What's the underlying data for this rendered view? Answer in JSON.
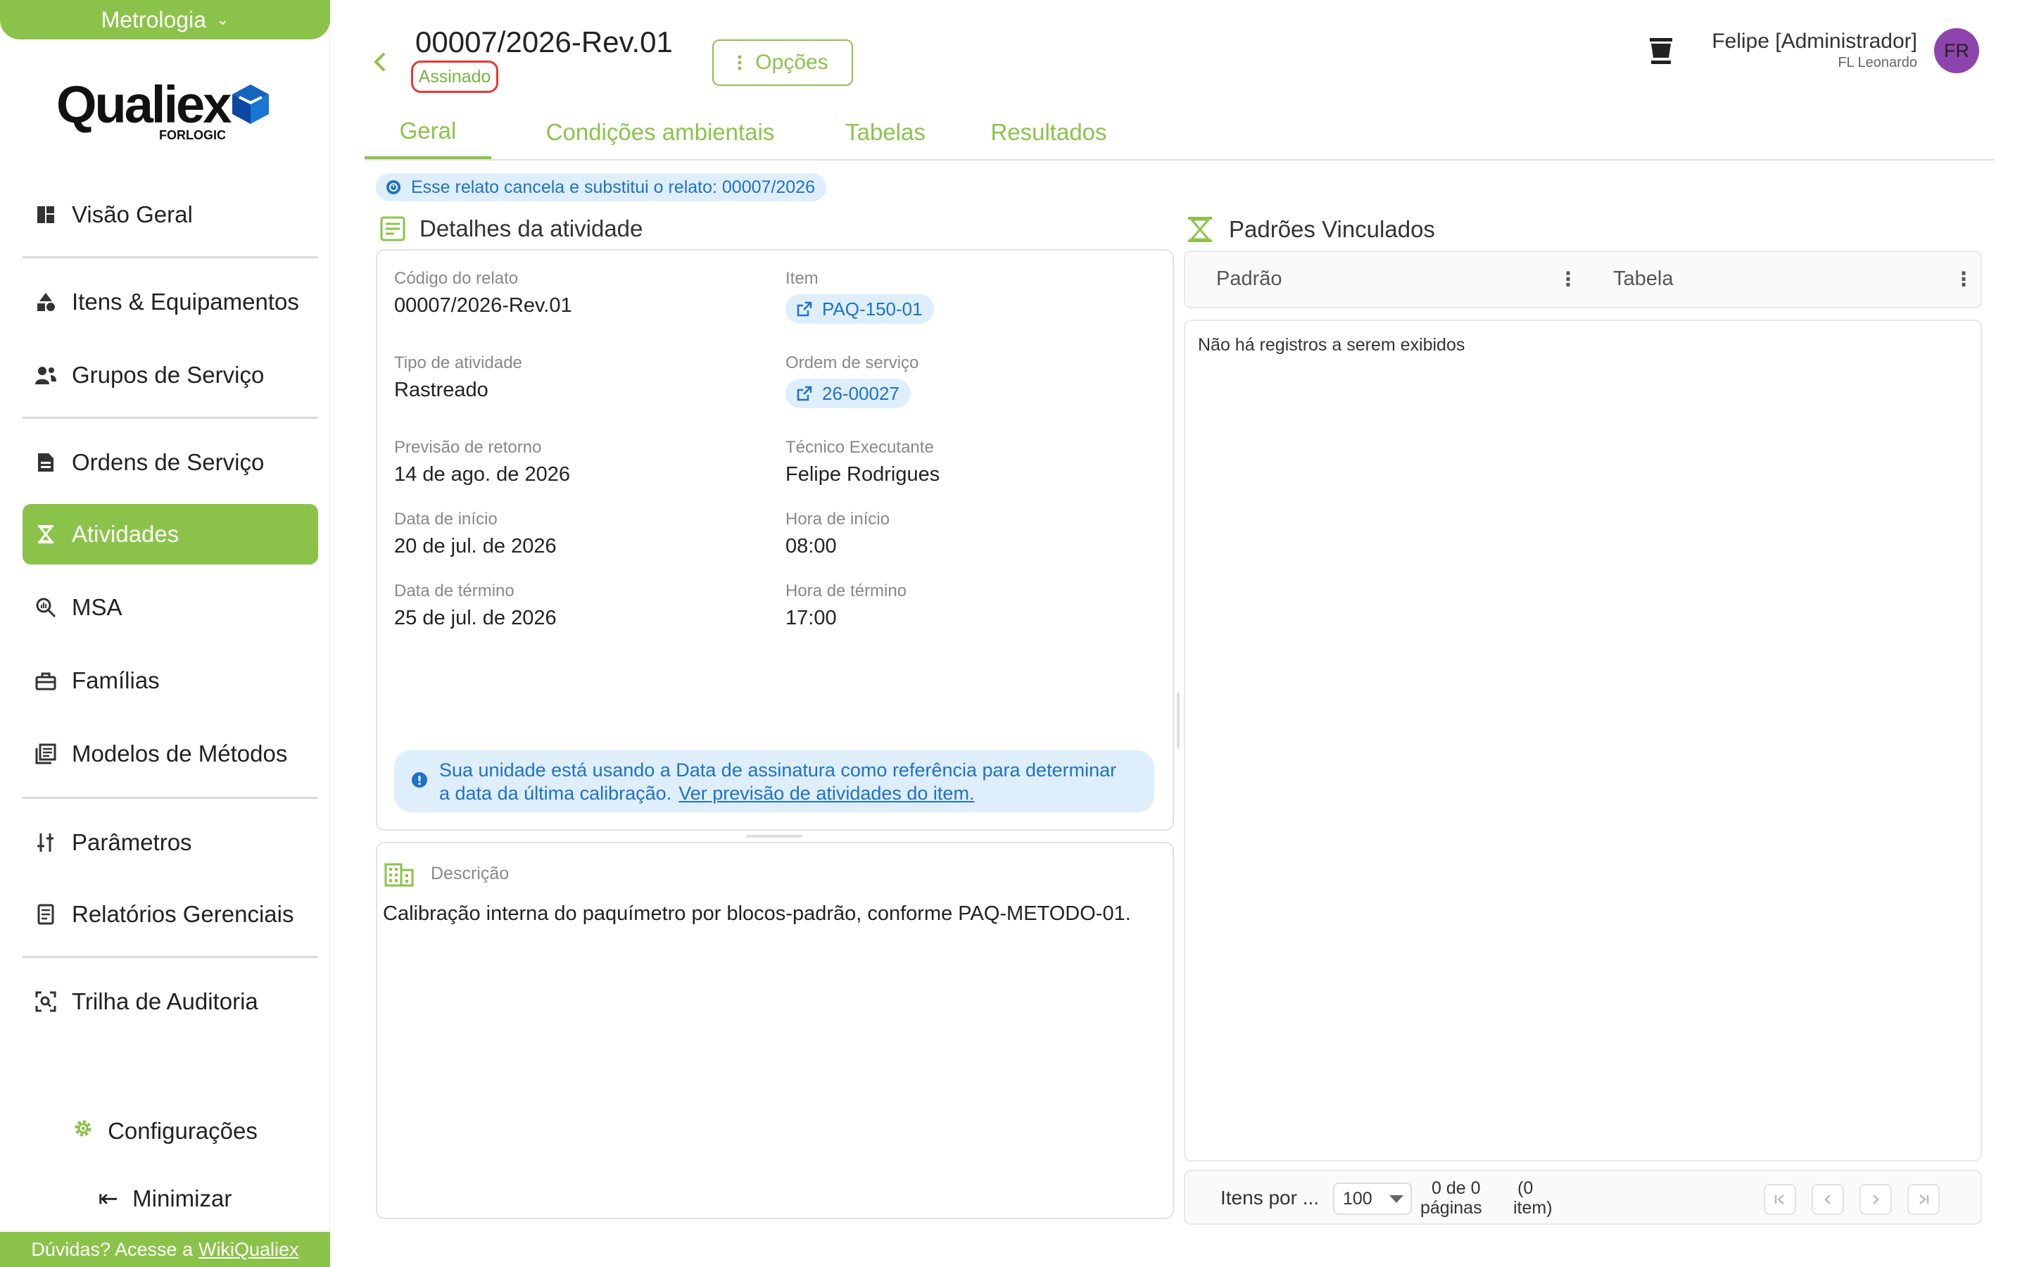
{
  "sidebar": {
    "module_label": "Metrologia",
    "logo_text": "Qualiex",
    "logo_sub": "FORLOGIC",
    "items": [
      {
        "label": "Visão Geral"
      },
      {
        "label": "Itens & Equipamentos"
      },
      {
        "label": "Grupos de Serviço"
      },
      {
        "label": "Ordens de Serviço"
      },
      {
        "label": "Atividades"
      },
      {
        "label": "MSA"
      },
      {
        "label": "Famílias"
      },
      {
        "label": "Modelos de Métodos"
      },
      {
        "label": "Parâmetros"
      },
      {
        "label": "Relatórios Gerenciais"
      },
      {
        "label": "Trilha de Auditoria"
      }
    ],
    "active_item": "Atividades",
    "settings_label": "Configurações",
    "minimize_label": "Minimizar",
    "help_text": "Dúvidas? Acesse a",
    "help_link": "WikiQualiex"
  },
  "header": {
    "title": "00007/2026-Rev.01",
    "status": "Assinado",
    "options_label": "Opções",
    "user_name": "Felipe [Administrador]",
    "user_sub": "FL Leonardo",
    "avatar_initials": "FR"
  },
  "tabs": [
    {
      "label": "Geral"
    },
    {
      "label": "Condições ambientais"
    },
    {
      "label": "Tabelas"
    },
    {
      "label": "Resultados"
    }
  ],
  "info_chip": "Esse relato cancela e substitui o relato: 00007/2026",
  "details": {
    "section_title": "Detalhes da atividade",
    "codigo_label": "Código do relato",
    "codigo_value": "00007/2026-Rev.01",
    "item_label": "Item",
    "item_value": "PAQ-150-01",
    "tipo_label": "Tipo de atividade",
    "tipo_value": "Rastreado",
    "ordem_label": "Ordem de serviço",
    "ordem_value": "26-00027",
    "previsao_label": "Previsão de retorno",
    "previsao_value": "14 de ago. de 2026",
    "tecnico_label": "Técnico Executante",
    "tecnico_value": "Felipe Rodrigues",
    "data_inicio_label": "Data de início",
    "data_inicio_value": "20 de jul. de 2026",
    "hora_inicio_label": "Hora de início",
    "hora_inicio_value": "08:00",
    "data_termino_label": "Data de término",
    "data_termino_value": "25 de jul. de 2026",
    "hora_termino_label": "Hora de término",
    "hora_termino_value": "17:00",
    "notice_line1": "Sua unidade está usando a Data de assinatura como referência para determinar",
    "notice_line2": "a data da última calibração.",
    "notice_link": "Ver previsão de atividades do item."
  },
  "description": {
    "label": "Descrição",
    "text": "Calibração interna do paquímetro por blocos-padrão, conforme PAQ-METODO-01."
  },
  "patterns": {
    "section_title": "Padrões Vinculados",
    "col_padrao": "Padrão",
    "col_tabela": "Tabela",
    "empty_message": "Não há registros a serem exibidos",
    "pager_label": "Itens por ...",
    "page_size": "100",
    "count_line1": "0 de 0",
    "count_line2": "páginas",
    "count_extra1": "(0",
    "count_extra2": "item)"
  },
  "colors": {
    "accent": "#8bc34a",
    "info_blue": "#1e72c8",
    "info_bg": "#dfeefb",
    "status_border": "#e53935",
    "avatar": "#8e44ad"
  }
}
